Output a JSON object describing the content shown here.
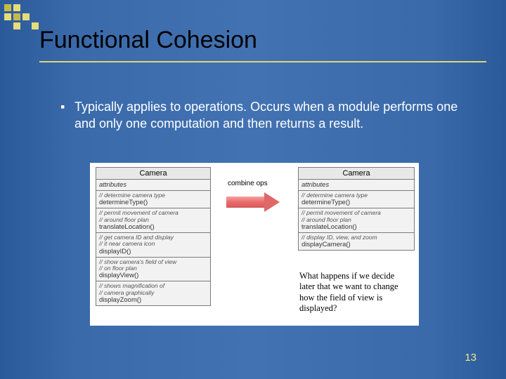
{
  "title": "Functional Cohesion",
  "bullet": "Typically applies to operations. Occurs when a module performs one and only one computation and then returns a result.",
  "page_number": "13",
  "combine_label": "combine ops",
  "question": "What happens if we decide later that we want to change how the field of view is displayed?",
  "left_class": {
    "name": "Camera",
    "attrs_label": "attributes",
    "groups": [
      {
        "comment": "// determine camera type",
        "op": "determineType()"
      },
      {
        "comment": "// permit movement of camera\n// around floor plan",
        "op": "translateLocation()"
      },
      {
        "comment": "// get camera ID and display\n// it near camera icon",
        "op": "displayID()"
      },
      {
        "comment": "// show camera's field of view\n// on floor plan",
        "op": "displayView()"
      },
      {
        "comment": "// shows magnification of\n// camera graphically",
        "op": "displayZoom()"
      }
    ]
  },
  "right_class": {
    "name": "Camera",
    "attrs_label": "attributes",
    "groups": [
      {
        "comment": "// determine camera type",
        "op": "determineType()"
      },
      {
        "comment": "// permit movement of camera\n// around floor plan",
        "op": "translateLocation()"
      },
      {
        "comment": "// display ID, view, and zoom",
        "op": "displayCamera()"
      }
    ]
  }
}
